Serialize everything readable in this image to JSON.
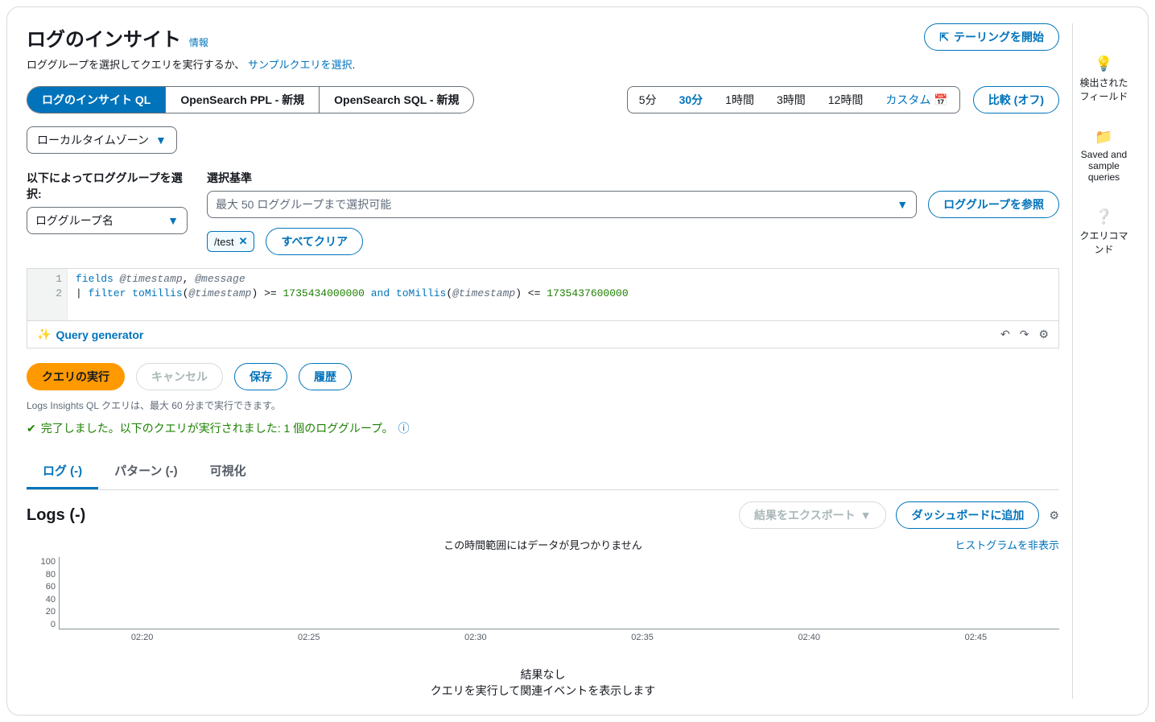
{
  "header": {
    "title": "ログのインサイト",
    "info_link": "情報",
    "subtitle_prefix": "ロググループを選択してクエリを実行するか、",
    "sample_link": "サンプルクエリを選択",
    "tailing_button": "テーリングを開始"
  },
  "query_lang_tabs": {
    "ql": "ログのインサイト QL",
    "ppl": "OpenSearch PPL - 新規",
    "sql": "OpenSearch SQL - 新規"
  },
  "time_range": {
    "m5": "5分",
    "m30": "30分",
    "h1": "1時間",
    "h3": "3時間",
    "h12": "12時間",
    "custom": "カスタム"
  },
  "compare_button": "比較 (オフ)",
  "timezone": "ローカルタイムゾーン",
  "select_by": {
    "label": "以下によってロググループを選択:",
    "value": "ロググループ名"
  },
  "criteria": {
    "label": "選択基準",
    "placeholder": "最大 50 ロググループまで選択可能",
    "browse_button": "ロググループを参照",
    "token": "/test",
    "clear_all": "すべてクリア"
  },
  "editor": {
    "line1": "fields @timestamp, @message",
    "line2_prefix": "| filter ",
    "line2_fn1": "toMillis",
    "line2_var": "@timestamp",
    "line2_ge": ">=",
    "line2_num1": "1735434000000",
    "line2_and": "and",
    "line2_le": "<=",
    "line2_num2": "1735437600000"
  },
  "query_generator": "Query generator",
  "actions": {
    "run": "クエリの実行",
    "cancel": "キャンセル",
    "save": "保存",
    "history": "履歴"
  },
  "note": "Logs Insights QL クエリは、最大 60 分まで実行できます。",
  "status": "完了しました。以下のクエリが実行されました: 1 個のロググループ。",
  "tabs": {
    "logs": "ログ (-)",
    "patterns": "パターン (-)",
    "viz": "可視化"
  },
  "logs_panel": {
    "title": "Logs (-)",
    "export": "結果をエクスポート",
    "add_dashboard": "ダッシュボードに追加",
    "hide_histogram": "ヒストグラムを非表示"
  },
  "chart_data": {
    "type": "bar",
    "title": "この時間範囲にはデータが見つかりません",
    "categories": [
      "02:20",
      "02:25",
      "02:30",
      "02:35",
      "02:40",
      "02:45"
    ],
    "values": [
      0,
      0,
      0,
      0,
      0,
      0
    ],
    "y_ticks": [
      "100",
      "80",
      "60",
      "40",
      "20",
      "0"
    ],
    "ylim": [
      0,
      100
    ],
    "xlabel": "",
    "ylabel": ""
  },
  "no_results": {
    "title": "結果なし",
    "sub": "クエリを実行して関連イベントを表示します"
  },
  "side_rail": {
    "fields": "検出されたフィールド",
    "saved": "Saved and sample queries",
    "commands": "クエリコマンド"
  }
}
